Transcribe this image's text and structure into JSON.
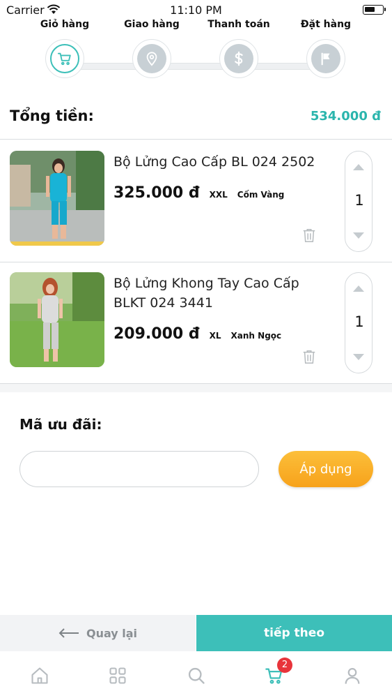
{
  "status_bar": {
    "carrier": "Carrier",
    "time": "11:10 PM"
  },
  "steps": [
    {
      "label": "Giỏ hàng",
      "icon": "cart-icon",
      "active": true
    },
    {
      "label": "Giao hàng",
      "icon": "location-pin-icon",
      "active": false
    },
    {
      "label": "Thanh toán",
      "icon": "dollar-icon",
      "active": false
    },
    {
      "label": "Đặt hàng",
      "icon": "flag-icon",
      "active": false
    }
  ],
  "total": {
    "label": "Tổng tiền:",
    "value": "534.000 đ"
  },
  "cart_items": [
    {
      "name": "Bộ Lửng Cao Cấp BL 024 2502",
      "price": "325.000 đ",
      "size": "XXL",
      "color": "Cốm Vàng",
      "quantity": "1",
      "photo": "woman-in-blue-outfit-photo"
    },
    {
      "name": "Bộ Lửng Khong Tay Cao Cấp BLKT 024 3441",
      "price": "209.000 đ",
      "size": "XL",
      "color": "Xanh Ngọc",
      "quantity": "1",
      "photo": "woman-in-grey-outfit-photo"
    }
  ],
  "coupon": {
    "label": "Mã ưu đãi:",
    "input_value": "",
    "apply_label": "Áp dụng"
  },
  "actions": {
    "back_label": "Quay lại",
    "next_label": "tiếp theo"
  },
  "tabbar": {
    "items": [
      "home-icon",
      "grid-icon",
      "search-icon",
      "cart-icon",
      "user-icon"
    ],
    "cart_badge": "2"
  },
  "colors": {
    "accent": "#3dbfb9",
    "total": "#2bb5ad",
    "apply_button": "#f7a21b",
    "badge": "#e8343b",
    "inactive_step": "#c8d0d5"
  }
}
